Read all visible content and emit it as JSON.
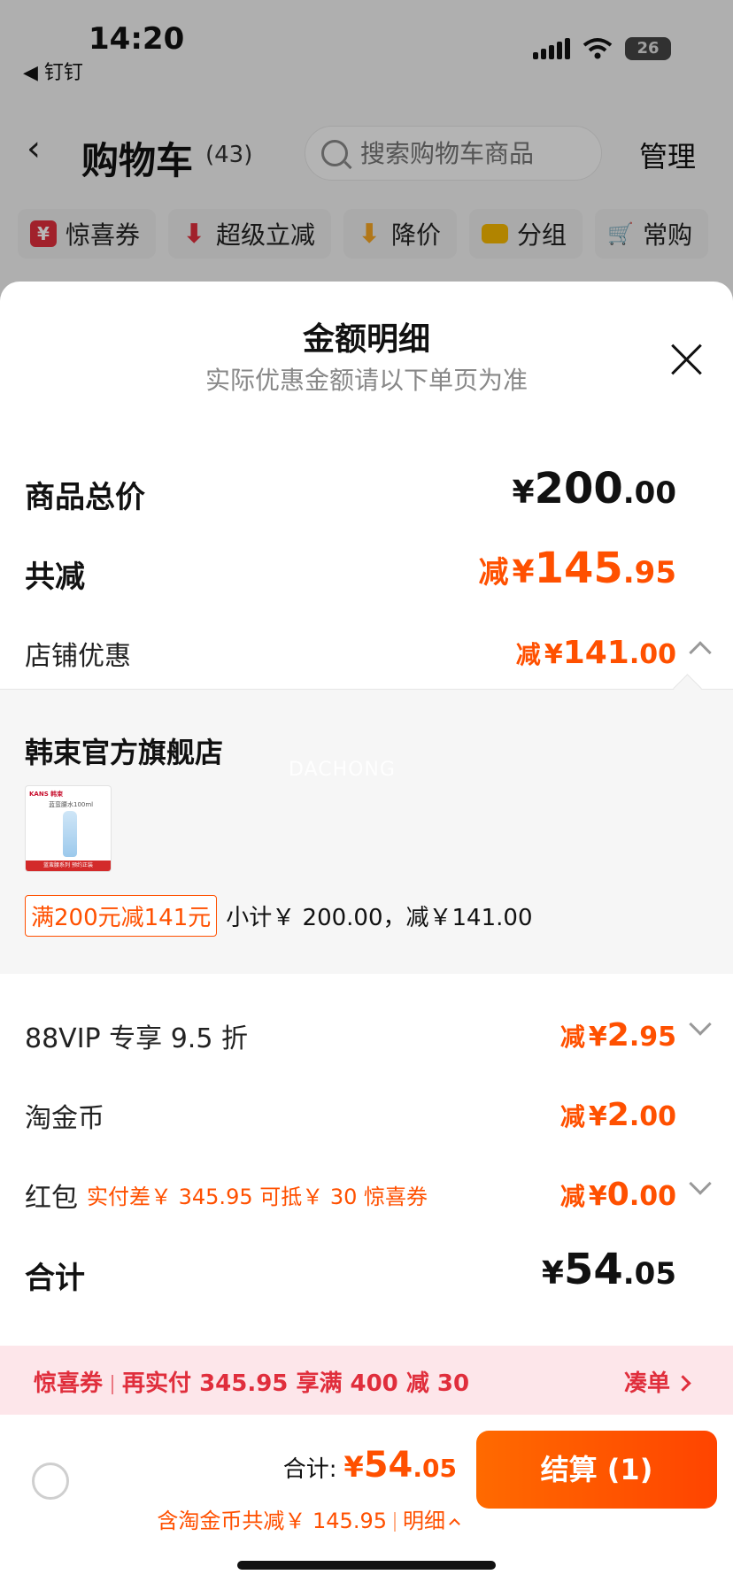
{
  "status_bar": {
    "time": "14:20",
    "back_app": "◀ 钉钉",
    "battery": "26"
  },
  "header": {
    "title": "购物车",
    "count": "(43)",
    "search_placeholder": "搜索购物车商品",
    "manage": "管理"
  },
  "chips": [
    {
      "label": "惊喜券",
      "icon": "coupon-icon",
      "color": "#e02e3c",
      "glyph": "¥"
    },
    {
      "label": "超级立减",
      "icon": "down-arrow-icon",
      "color": "#e02e3c",
      "glyph": "⬇"
    },
    {
      "label": "降价",
      "icon": "price-drop-icon",
      "color": "#f5a623",
      "glyph": "⬇"
    },
    {
      "label": "分组",
      "icon": "folder-icon",
      "color": "#f5b700",
      "glyph": "▬"
    },
    {
      "label": "常购",
      "icon": "cart-icon",
      "color": "#ff8c00",
      "glyph": "🛒"
    }
  ],
  "sheet": {
    "title": "金额明细",
    "subtitle": "实际优惠金额请以下单页为准",
    "total_price": {
      "label": "商品总价",
      "currency": "¥",
      "int": "200",
      "dec": ".00"
    },
    "total_discount": {
      "label": "共减",
      "prefix": "减",
      "currency": "¥",
      "int": "145",
      "dec": ".95"
    },
    "shop_discount": {
      "label": "店铺优惠",
      "prefix": "减",
      "currency": "¥",
      "int": "141",
      "dec": ".00"
    },
    "store": {
      "name": "韩束官方旗舰店",
      "watermark": "DACHONG",
      "product_brand": "KANS 韩束",
      "product_name": "蓝蛮腰水100ml",
      "product_band": "蓝蛮腰系列 预约正装",
      "promo_tag": "满200元减141元",
      "promo_detail": "小计￥ 200.00，减￥141.00"
    },
    "vip": {
      "label": "88VIP 专享 9.5 折",
      "prefix": "减",
      "currency": "¥",
      "int": "2",
      "dec": ".95"
    },
    "taojinbi": {
      "label": "淘金币",
      "prefix": "减",
      "currency": "¥",
      "int": "2",
      "dec": ".00"
    },
    "hongbao": {
      "label": "红包",
      "note": "实付差￥ 345.95 可抵￥ 30 惊喜券",
      "prefix": "减",
      "currency": "¥",
      "int": "0",
      "dec": ".00"
    },
    "sum": {
      "label": "合计",
      "currency": "¥",
      "int": "54",
      "dec": ".05"
    }
  },
  "banner": {
    "tag": "惊喜券",
    "text": "再实付 345.95 享满 400 减 30",
    "link": "凑单"
  },
  "bottom": {
    "total_label": "合计:",
    "currency": "¥",
    "int": "54",
    "dec": ".05",
    "sub_text": "含淘金币共减￥ 145.95",
    "detail": "明细",
    "checkout": "结算 (1)"
  },
  "colors": {
    "accent": "#ff5000",
    "banner_red": "#e02e3c"
  }
}
